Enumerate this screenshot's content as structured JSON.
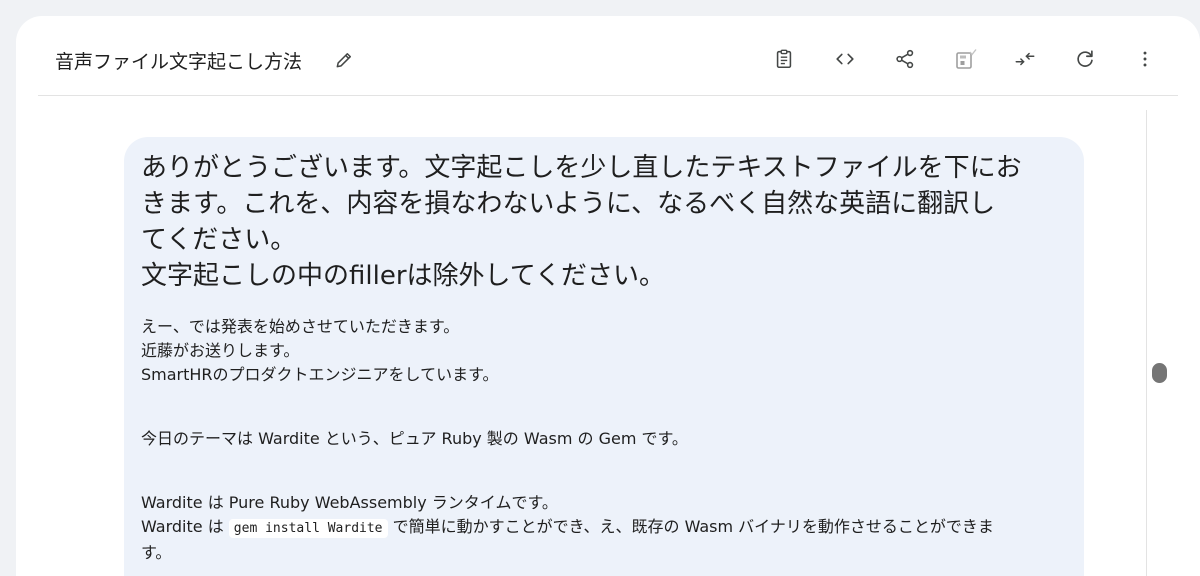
{
  "header": {
    "title": "音声ファイル文字起こし方法",
    "tools": [
      "clipboard-icon",
      "code-icon",
      "share-icon",
      "save-to-drive-icon",
      "collapse-icon",
      "refresh-icon",
      "more-vert-icon"
    ]
  },
  "prompt": {
    "lines": [
      "ありがとうございます。文字起こしを少し直したテキストファイルを下にお",
      "きます。これを、内容を損なわないように、なるべく自然な英語に翻訳し",
      "てください。",
      "文字起こしの中のfillerは除外してください。"
    ]
  },
  "pasted": {
    "block1": [
      "えー、では発表を始めさせていただきます。",
      "近藤がお送りします。",
      "SmartHRのプロダクトエンジニアをしています。"
    ],
    "block2": "今日のテーマは Wardite という、ピュア Ruby 製の Wasm の Gem です。",
    "block3_line1": "Wardite は Pure Ruby WebAssembly ランタイムです。",
    "block3_line2_pre": "Wardite は ",
    "block3_line2_code": "gem install Wardite",
    "block3_line2_post": " で簡単に動かすことができ、え、既存の Wasm バイナリを動作させることができま",
    "block3_line3": "す。"
  }
}
